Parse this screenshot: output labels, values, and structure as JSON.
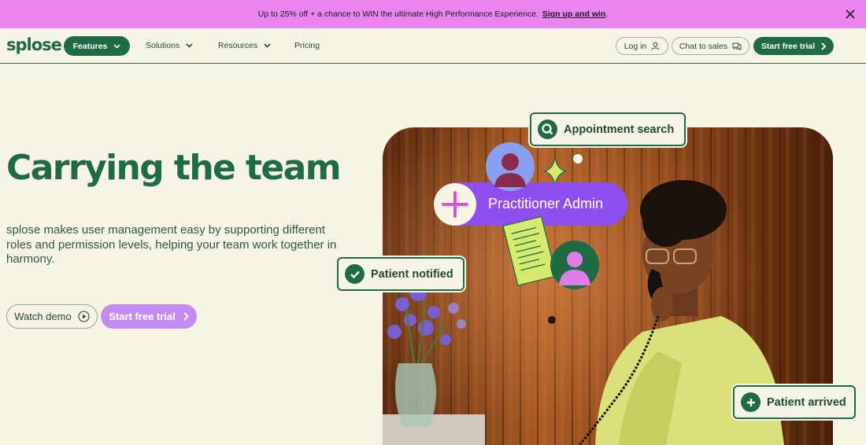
{
  "promo": {
    "text": "Up to 25% off + a chance to WIN the ultimate High Performance Experience.",
    "link": "Sign up and win",
    "link_suffix": "."
  },
  "nav": {
    "logo": "splose",
    "items": [
      {
        "label": "Features"
      },
      {
        "label": "Solutions"
      },
      {
        "label": "Resources"
      },
      {
        "label": "Pricing"
      }
    ],
    "login": "Log in",
    "chat": "Chat to sales",
    "trial": "Start free trial"
  },
  "hero": {
    "title": "Carrying the team",
    "description": "splose makes user management easy by supporting different roles and permission levels, helping your team work together in harmony.",
    "watch_demo": "Watch demo",
    "start_trial": "Start free trial"
  },
  "illustration": {
    "appointment_search": "Appointment search",
    "practitioner_admin": "Practitioner Admin",
    "patient_notified": "Patient notified",
    "patient_arrived": "Patient arrived"
  },
  "colors": {
    "brand_green": "#1f6b45",
    "promo_pink": "#ea85f0",
    "accent_purple": "#8e4ff0",
    "button_purple": "#c28cf2",
    "background": "#f7f4e6"
  }
}
